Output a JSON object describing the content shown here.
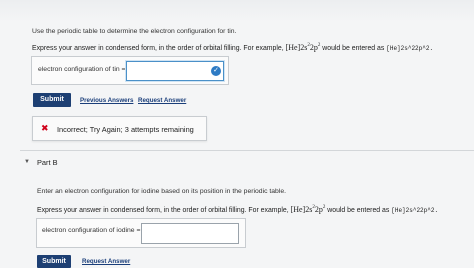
{
  "part_a": {
    "instruction": "Use the periodic table to determine the electron configuration for tin.",
    "format_text": "Express your answer in condensed form, in the order of orbital filling. For example,",
    "example_math": {
      "core": "[He]",
      "s": "2s",
      "s_exp": "2",
      "p": "2p",
      "p_exp": "2"
    },
    "entered_as_text": "would be entered as",
    "entered_as_code": "[He]2s^22p^2.",
    "field_label": "electron configuration of tin =",
    "field_value": "",
    "submit_label": "Submit",
    "previous_answers_label": "Previous Answers",
    "request_answer_label": "Request Answer",
    "feedback": {
      "icon": "x-icon",
      "message": "Incorrect; Try Again; 3 attempts remaining"
    }
  },
  "part_b": {
    "title": "Part B",
    "instruction": "Enter an electron configuration for iodine based on its position in the periodic table.",
    "format_text": "Express your answer in condensed form, in the order of orbital filling. For example,",
    "example_math": {
      "core": "[He]",
      "s": "2s",
      "s_exp": "2",
      "p": "2p",
      "p_exp": "2"
    },
    "entered_as_text": "would be entered as",
    "entered_as_code": "[He]2s^22p^2.",
    "field_label": "electron configuration of iodine =",
    "field_value": "",
    "submit_label": "Submit",
    "request_answer_label": "Request Answer"
  },
  "colors": {
    "submit_bg": "#1d3f73",
    "link": "#1a3e7a",
    "error": "#d0021b",
    "check": "#2e7bc4"
  }
}
